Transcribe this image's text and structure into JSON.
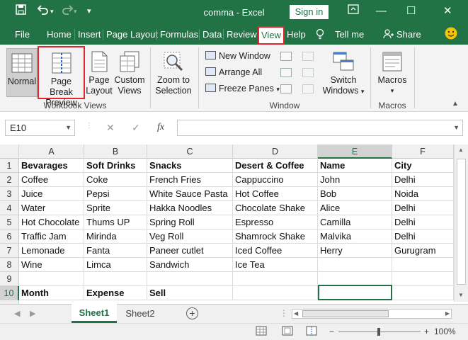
{
  "title_bar": {
    "save_icon": "save-icon",
    "undo_icon": "undo-icon",
    "redo_icon": "redo-icon",
    "customize_icon": "qat-dropdown-icon",
    "title": "comma  -  Excel",
    "signin_label": "Sign in",
    "ribbon_display_icon": "ribbon-display-icon",
    "minimize": "—",
    "maximize": "☐",
    "close": "✕"
  },
  "menu": {
    "file": "File",
    "home": "Home",
    "insert": "Insert",
    "page_layout": "Page Layout",
    "formulas": "Formulas",
    "data": "Data",
    "review": "Review",
    "view": "View",
    "help": "Help",
    "tell_me": "Tell me",
    "share": "Share"
  },
  "ribbon": {
    "workbook_views": {
      "normal": "Normal",
      "page_break_line1": "Page Break",
      "page_break_line2": "Preview",
      "page_layout_line1": "Page",
      "page_layout_line2": "Layout",
      "custom_line1": "Custom",
      "custom_line2": "Views",
      "group": "Workbook Views"
    },
    "zoom": {
      "line1": "Zoom to",
      "line2": "Selection"
    },
    "window": {
      "new_window": "New Window",
      "arrange_all": "Arrange All",
      "freeze_panes": "Freeze Panes",
      "switch_line1": "Switch",
      "switch_line2": "Windows",
      "group": "Window"
    },
    "macros": {
      "label": "Macros",
      "group": "Macros"
    }
  },
  "formula_bar": {
    "name_box": "E10",
    "cancel": "✕",
    "enter": "✓",
    "fx": "fx",
    "formula": ""
  },
  "columns": [
    "A",
    "B",
    "C",
    "D",
    "E",
    "F"
  ],
  "rows": [
    "1",
    "2",
    "3",
    "4",
    "5",
    "6",
    "7",
    "8",
    "9",
    "10"
  ],
  "cells": [
    [
      "Bevarages",
      "Soft Drinks",
      "Snacks",
      "Desert & Coffee",
      "Name",
      "City"
    ],
    [
      "Coffee",
      "Coke",
      "French Fries",
      "Cappuccino",
      "John",
      "Delhi"
    ],
    [
      "Juice",
      "Pepsi",
      "White Sauce Pasta",
      "Hot Coffee",
      "Bob",
      "Noida"
    ],
    [
      "Water",
      "Sprite",
      "Hakka Noodles",
      "Chocolate Shake",
      "Alice",
      "Delhi"
    ],
    [
      "Hot Chocolate",
      "Thums UP",
      "Spring Roll",
      "Espresso",
      "Camilla",
      "Delhi"
    ],
    [
      "Traffic Jam",
      "Mirinda",
      "Veg Roll",
      "Shamrock Shake",
      "Malvika",
      "Delhi"
    ],
    [
      "Lemonade",
      "Fanta",
      "Paneer cutlet",
      "Iced Coffee",
      "Herry",
      "Gurugram"
    ],
    [
      "Wine",
      "Limca",
      "Sandwich",
      "Ice Tea",
      "",
      ""
    ],
    [
      "",
      "",
      "",
      "",
      "",
      ""
    ],
    [
      "Month",
      "Expense",
      "Sell",
      "",
      "",
      ""
    ]
  ],
  "sheets": {
    "sheet1": "Sheet1",
    "sheet2": "Sheet2",
    "add": "+"
  },
  "status": {
    "zoom": "100%",
    "minus": "−",
    "plus": "+"
  },
  "accent": "#217346",
  "highlight": "#e0272e"
}
